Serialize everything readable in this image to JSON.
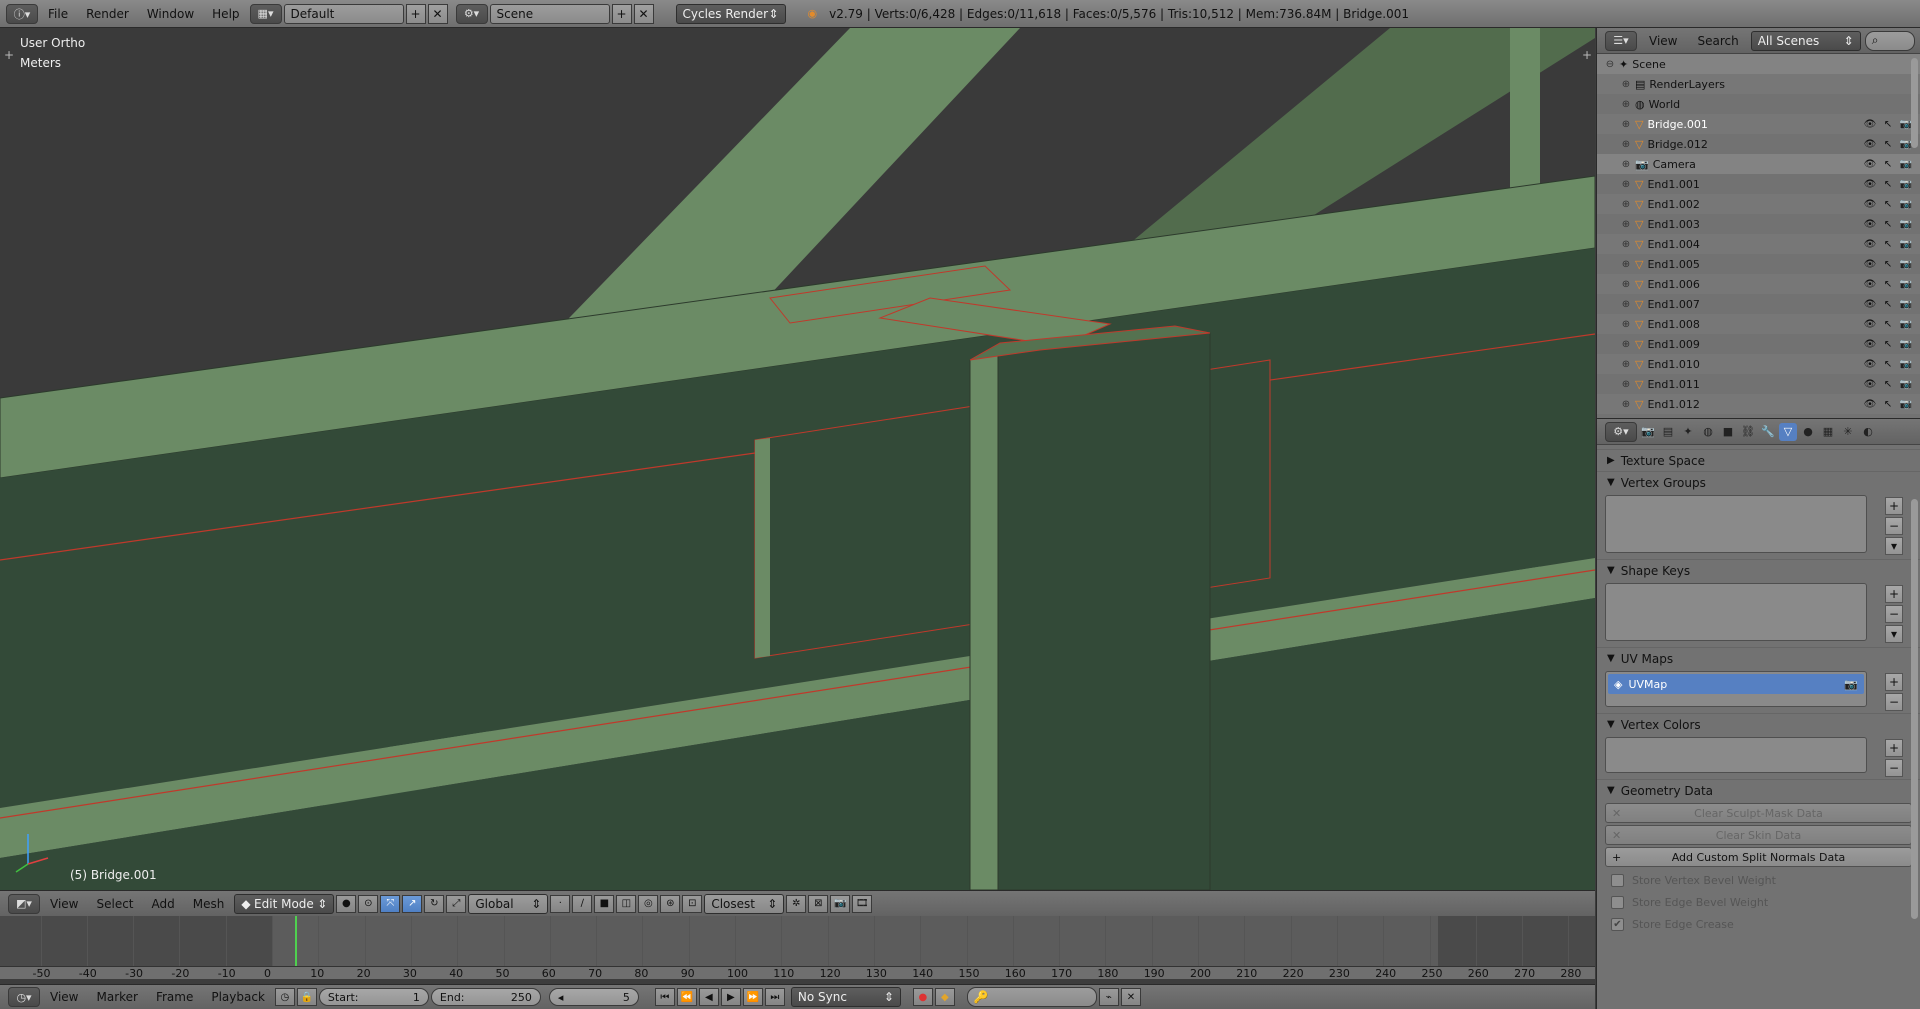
{
  "topbar": {
    "menus": [
      "File",
      "Render",
      "Window",
      "Help"
    ],
    "layout": "Default",
    "scene": "Scene",
    "engine": "Cycles Render",
    "stats": "v2.79 | Verts:0/6,428 | Edges:0/11,618 | Faces:0/5,576 | Tris:10,512 | Mem:736.84M | Bridge.001"
  },
  "viewport": {
    "view_name": "User Ortho",
    "units": "Meters",
    "object_label": "(5) Bridge.001",
    "colors": {
      "background": "#3a3a3a",
      "face_light": "#6b8b65",
      "face_mid": "#557250",
      "face_dark": "#334a38",
      "edge_selected": "#c0392b"
    }
  },
  "vpheader": {
    "menus": [
      "View",
      "Select",
      "Add",
      "Mesh"
    ],
    "mode": "Edit Mode",
    "orientation": "Global",
    "snap": "Closest"
  },
  "timeline": {
    "ticks": [
      "-50",
      "-40",
      "-30",
      "-20",
      "-10",
      "0",
      "10",
      "20",
      "30",
      "40",
      "50",
      "60",
      "70",
      "80",
      "90",
      "100",
      "110",
      "120",
      "130",
      "140",
      "150",
      "160",
      "170",
      "180",
      "190",
      "200",
      "210",
      "220",
      "230",
      "240",
      "250",
      "260",
      "270",
      "280"
    ],
    "menus": [
      "View",
      "Marker",
      "Frame",
      "Playback"
    ],
    "start_label": "Start:",
    "start": "1",
    "end_label": "End:",
    "end": "250",
    "current": "5",
    "sync": "No Sync"
  },
  "outliner": {
    "menus": [
      "View",
      "Search"
    ],
    "filter": "All Scenes",
    "items": [
      {
        "name": "Scene",
        "icon": "scene-icon",
        "level": 0
      },
      {
        "name": "RenderLayers",
        "icon": "renderlayers-icon",
        "level": 1
      },
      {
        "name": "World",
        "icon": "world-icon",
        "level": 1
      },
      {
        "name": "Bridge.001",
        "icon": "mesh-icon",
        "level": 1,
        "highlight": true
      },
      {
        "name": "Bridge.012",
        "icon": "mesh-icon",
        "level": 1
      },
      {
        "name": "Camera",
        "icon": "camera-icon",
        "level": 1
      },
      {
        "name": "End1.001",
        "icon": "mesh-icon",
        "level": 1
      },
      {
        "name": "End1.002",
        "icon": "mesh-icon",
        "level": 1
      },
      {
        "name": "End1.003",
        "icon": "mesh-icon",
        "level": 1
      },
      {
        "name": "End1.004",
        "icon": "mesh-icon",
        "level": 1
      },
      {
        "name": "End1.005",
        "icon": "mesh-icon",
        "level": 1
      },
      {
        "name": "End1.006",
        "icon": "mesh-icon",
        "level": 1
      },
      {
        "name": "End1.007",
        "icon": "mesh-icon",
        "level": 1
      },
      {
        "name": "End1.008",
        "icon": "mesh-icon",
        "level": 1
      },
      {
        "name": "End1.009",
        "icon": "mesh-icon",
        "level": 1
      },
      {
        "name": "End1.010",
        "icon": "mesh-icon",
        "level": 1
      },
      {
        "name": "End1.011",
        "icon": "mesh-icon",
        "level": 1
      },
      {
        "name": "End1.012",
        "icon": "mesh-icon",
        "level": 1
      }
    ]
  },
  "properties": {
    "panels": {
      "texture_space": "Texture Space",
      "vertex_groups": "Vertex Groups",
      "shape_keys": "Shape Keys",
      "uv_maps": "UV Maps",
      "vertex_colors": "Vertex Colors",
      "geometry_data": "Geometry Data"
    },
    "uvmap_name": "UVMap",
    "buttons": {
      "clear_sculpt": "Clear Sculpt-Mask Data",
      "clear_skin": "Clear Skin Data",
      "add_split": "Add Custom Split Normals Data"
    },
    "checks": {
      "vertex_bevel": "Store Vertex Bevel Weight",
      "edge_bevel": "Store Edge Bevel Weight",
      "edge_crease": "Store Edge Crease"
    }
  }
}
